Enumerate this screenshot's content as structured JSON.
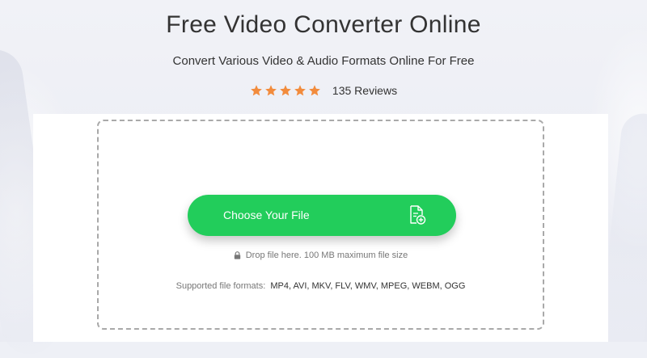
{
  "header": {
    "title": "Free Video Converter Online",
    "subtitle": "Convert Various Video & Audio Formats Online For Free"
  },
  "rating": {
    "stars": 5,
    "max_stars": 5,
    "reviews_text": "135 Reviews",
    "star_color": "#f28b3c"
  },
  "upload": {
    "button_label": "Choose Your File",
    "button_color": "#22cd5b",
    "button_icon": "file-add-icon",
    "drop_hint": "Drop file here. 100 MB maximum file size",
    "hint_icon": "lock-icon",
    "formats_label": "Supported file formats:",
    "formats_list": "MP4, AVI, MKV, FLV, WMV, MPEG, WEBM, OGG"
  }
}
